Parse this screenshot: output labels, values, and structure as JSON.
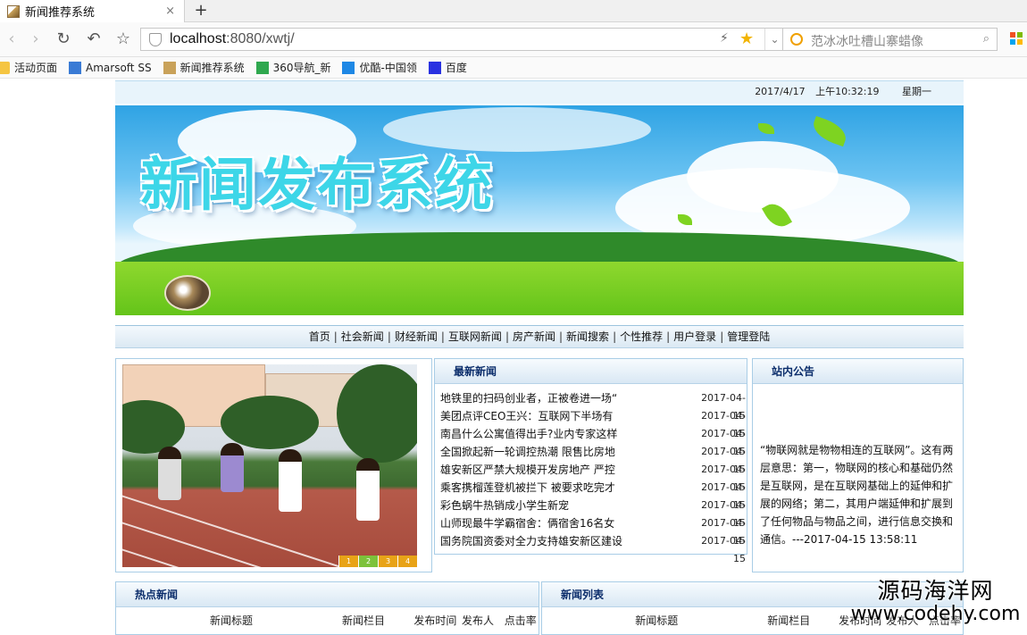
{
  "browser": {
    "tab_title": "新闻推荐系统",
    "tab_close": "×",
    "new_tab": "+",
    "url_host": "localhost",
    "url_rest": ":8080/xwtj/",
    "search_text": "范冰冰吐槽山寨蜡像",
    "bookmarks": [
      {
        "label": "活动页面",
        "icon": "folder-icon",
        "color": "#f5c542"
      },
      {
        "label": "Amarsoft SS",
        "icon": "eip-icon",
        "color": "#3a7bd5"
      },
      {
        "label": "新闻推荐系统",
        "icon": "site-favicon",
        "color": "#c9a25a"
      },
      {
        "label": "360导航_新",
        "icon": "360-icon",
        "color": "#2fa84f"
      },
      {
        "label": "优酷-中国领",
        "icon": "youku-icon",
        "color": "#1e88e5"
      },
      {
        "label": "百度",
        "icon": "baidu-paw-icon",
        "color": "#2932e1"
      }
    ]
  },
  "header": {
    "date": "2017/4/17",
    "time": "上午10:32:19",
    "weekday": "星期一",
    "banner_title": "新闻发布系统"
  },
  "menu": [
    "首页",
    "社会新闻",
    "财经新闻",
    "互联网新闻",
    "房产新闻",
    "新闻搜索",
    "个性推荐",
    "用户登录",
    "管理登陆"
  ],
  "slideshow": {
    "pages": [
      "1",
      "2",
      "3",
      "4"
    ],
    "active": 1
  },
  "latest": {
    "title": "最新新闻",
    "items": [
      {
        "title": "地铁里的扫码创业者，正被卷进一场“",
        "date": "2017-04-15"
      },
      {
        "title": "美团点评CEO王兴：互联网下半场有",
        "date": "2017-04-15"
      },
      {
        "title": "南昌什么公寓值得出手?业内专家这样",
        "date": "2017-04-15"
      },
      {
        "title": "全国掀起新一轮调控热潮 限售比房地",
        "date": "2017-04-15"
      },
      {
        "title": "雄安新区严禁大规模开发房地产 严控",
        "date": "2017-04-15"
      },
      {
        "title": "乘客携榴莲登机被拦下 被要求吃完才",
        "date": "2017-04-15"
      },
      {
        "title": "彩色蜗牛热销成小学生新宠",
        "date": "2017-04-15"
      },
      {
        "title": "山师现最牛学霸宿舍：俩宿舍16名女",
        "date": "2017-04-15"
      },
      {
        "title": "国务院国资委对全力支持雄安新区建设",
        "date": "2017-04-15"
      }
    ]
  },
  "notice": {
    "title": "站内公告",
    "text": "“物联网就是物物相连的互联网”。这有两层意思：第一，物联网的核心和基础仍然是互联网，是在互联网基础上的延伸和扩展的网络；第二，其用户端延伸和扩展到了任何物品与物品之间，进行信息交换和通信。---2017-04-15 13:58:11"
  },
  "hot": {
    "title": "热点新闻",
    "columns": [
      "新闻标题",
      "新闻栏目",
      "发布时间",
      "发布人",
      "点击率"
    ]
  },
  "list": {
    "title": "新闻列表",
    "columns": [
      "新闻标题",
      "新闻栏目",
      "发布时间",
      "发布人",
      "点击率"
    ]
  },
  "watermark": {
    "line1": "源码海洋网",
    "line2": "www.codehy.com"
  }
}
